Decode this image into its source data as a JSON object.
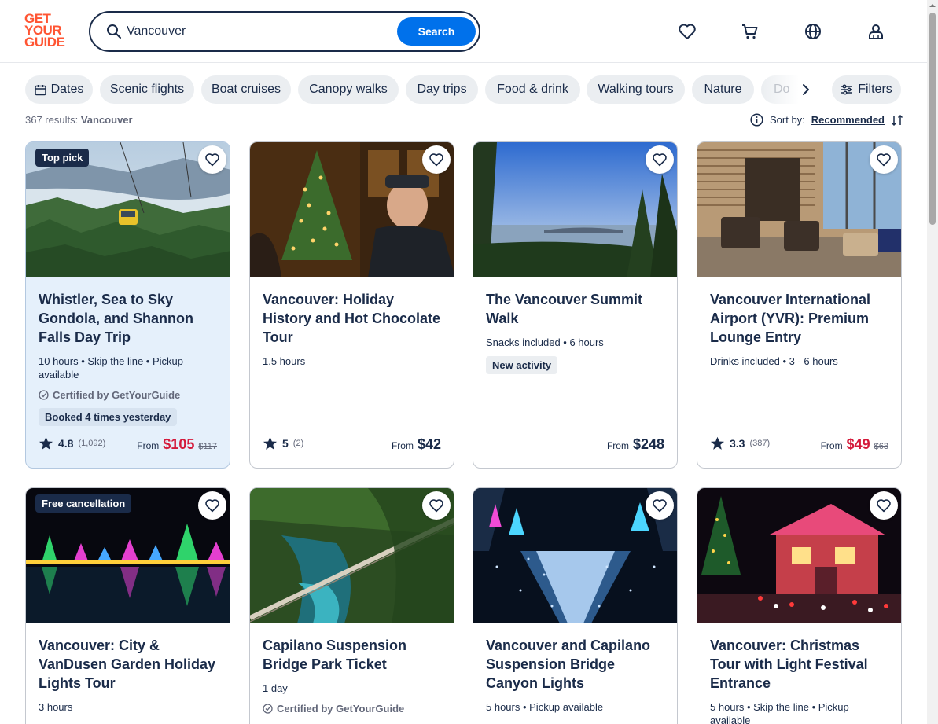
{
  "logo": {
    "line1": "GET",
    "line2": "YOUR",
    "line3": "GUIDE"
  },
  "search": {
    "value": "Vancouver",
    "button": "Search"
  },
  "header_icons": [
    "heart-icon",
    "cart-icon",
    "globe-icon",
    "account-icon"
  ],
  "chips": [
    "Dates",
    "Scenic flights",
    "Boat cruises",
    "Canopy walks",
    "Day trips",
    "Food & drink",
    "Walking tours",
    "Nature"
  ],
  "chip_cut": "Do",
  "filters_label": "Filters",
  "results": {
    "count": "367 results:",
    "query": "Vancouver"
  },
  "sort": {
    "label": "Sort by:",
    "value": "Recommended"
  },
  "cards": [
    {
      "badge": "Top pick",
      "title": "Whistler, Sea to Sky Gondola, and Shannon Falls Day Trip",
      "meta": "10 hours • Skip the line • Pickup available",
      "cert": "Certified by GetYourGuide",
      "tag": "Booked 4 times yesterday",
      "rating": "4.8",
      "reviews": "(1,092)",
      "from": "From",
      "price": "$105",
      "old": "$117"
    },
    {
      "title": "Vancouver: Holiday History and Hot Chocolate Tour",
      "meta": "1.5 hours",
      "rating": "5",
      "reviews": "(2)",
      "from": "From",
      "price": "$42"
    },
    {
      "title": "The Vancouver Summit Walk",
      "meta": "Snacks included • 6 hours",
      "tag": "New activity",
      "from": "From",
      "price": "$248"
    },
    {
      "title": "Vancouver International Airport (YVR): Premium Lounge Entry",
      "meta": "Drinks included • 3 - 6 hours",
      "rating": "3.3",
      "reviews": "(387)",
      "from": "From",
      "price": "$49",
      "old": "$63"
    },
    {
      "badge": "Free cancellation",
      "title": "Vancouver: City & VanDusen Garden Holiday Lights Tour",
      "meta": "3 hours"
    },
    {
      "title": "Capilano Suspension Bridge Park Ticket",
      "meta": "1 day",
      "cert": "Certified by GetYourGuide"
    },
    {
      "title": "Vancouver and Capilano Suspension Bridge Canyon Lights",
      "meta": "5 hours • Pickup available"
    },
    {
      "title": "Vancouver: Christmas Tour with Light Festival Entrance",
      "meta": "5 hours • Skip the line • Pickup available"
    }
  ],
  "colors": {
    "brand": "#ff5533",
    "accent": "#0071eb",
    "text": "#1a2b49",
    "sale": "#d4193a",
    "highlight": "#e5f0fb"
  }
}
